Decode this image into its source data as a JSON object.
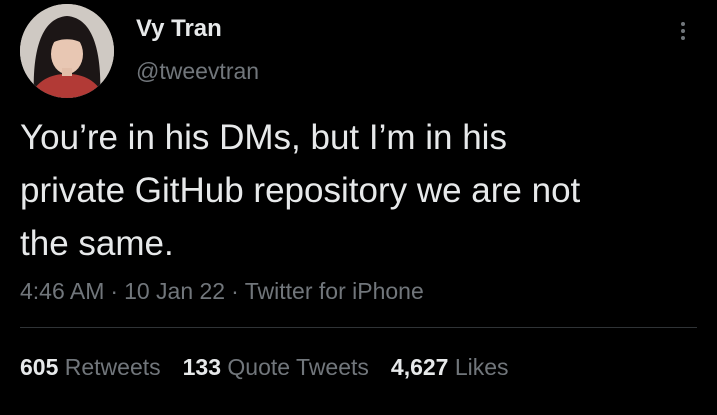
{
  "author": {
    "display_name": "Vy Tran",
    "handle": "@tweevtran"
  },
  "tweet": {
    "text": "You’re in his DMs, but I’m in his\nprivate GitHub repository we are not\nthe same.",
    "time": "4:46 AM",
    "date": "10 Jan 22",
    "source": "Twitter for iPhone",
    "separator": "·"
  },
  "stats": {
    "retweets_count": "605",
    "retweets_label": "Retweets",
    "quotes_count": "133",
    "quotes_label": "Quote Tweets",
    "likes_count": "4,627",
    "likes_label": "Likes"
  },
  "icons": {
    "more": "more-vertical-icon"
  },
  "colors": {
    "background": "#000000",
    "primary_text": "#e7e9ea",
    "secondary_text": "#71767b",
    "divider": "#2f3336"
  }
}
